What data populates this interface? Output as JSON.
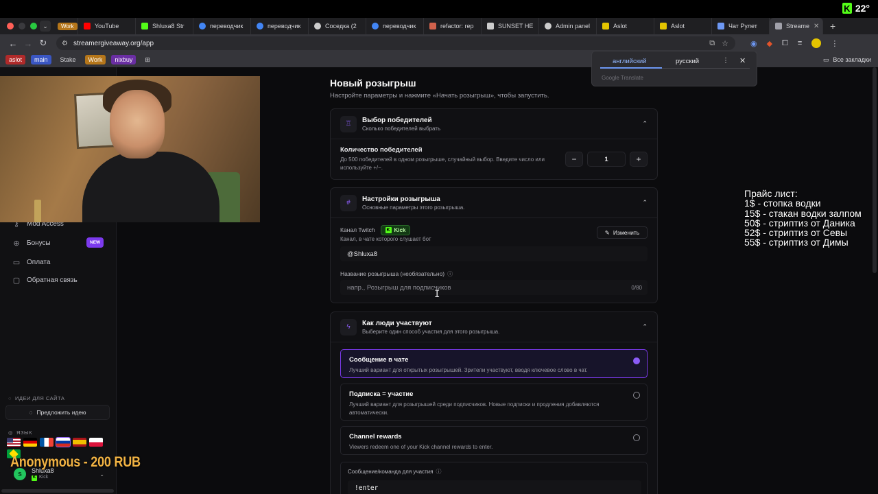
{
  "os": {
    "stream_badge": "22°"
  },
  "browser": {
    "tabs": [
      {
        "label": "Work",
        "type": "group"
      },
      {
        "label": "YouTube",
        "color": "#ff0000"
      },
      {
        "label": "Shluxa8 Str",
        "color": "#53fc18"
      },
      {
        "label": "переводчик",
        "color": "#4285f4"
      },
      {
        "label": "переводчик",
        "color": "#4285f4"
      },
      {
        "label": "Соседка (2",
        "color": "#cccccc"
      },
      {
        "label": "переводчик",
        "color": "#4285f4"
      },
      {
        "label": "refactor: rep",
        "color": "#d1624c"
      },
      {
        "label": "SUNSET HE",
        "color": "#cccccc"
      },
      {
        "label": "Admin panel",
        "color": "#cccccc"
      },
      {
        "label": "Aslot",
        "color": "#e4c400"
      },
      {
        "label": "Aslot",
        "color": "#e4c400"
      },
      {
        "label": "Чат Рулет",
        "color": "#6d98f4"
      },
      {
        "label": "Streame",
        "color": "#a1a1aa",
        "active": true
      }
    ],
    "url": "streamergiveaway.org/app",
    "bookmarks": [
      {
        "label": "aslot",
        "style": "red"
      },
      {
        "label": "main",
        "style": "blue"
      },
      {
        "label": "Stake",
        "style": "plain"
      },
      {
        "label": "Work",
        "style": "orange"
      },
      {
        "label": "nixbuy",
        "style": "purple"
      }
    ],
    "all_bookmarks_label": "Все закладки"
  },
  "translate_popup": {
    "source_lang": "английский",
    "target_lang": "русский",
    "footer": "Google Translate"
  },
  "sidebar": {
    "items": [
      {
        "label": "Mod Access",
        "icon": "key-icon"
      },
      {
        "label": "Бонусы",
        "icon": "gift-icon",
        "badge": "NEW"
      },
      {
        "label": "Оплата",
        "icon": "card-icon"
      },
      {
        "label": "Обратная связь",
        "icon": "chat-icon"
      }
    ],
    "ideas_heading": "ИДЕИ ДЛЯ САЙТА",
    "suggest_label": "Предложить идею",
    "language_heading": "ЯЗЫК",
    "user": {
      "name": "Shluxa8",
      "platform": "Kick",
      "initial": "S"
    }
  },
  "main": {
    "title": "Новый розыгрыш",
    "subtitle": "Настройте параметры и нажмите «Начать розыгрыш», чтобы запустить.",
    "winners_card": {
      "title": "Выбор победителей",
      "subtitle": "Сколько победителей выбрать",
      "count_label": "Количество победителей",
      "count_help": "До 500 победителей в одном розыгрыше, случайный выбор. Введите число или используйте +/−.",
      "count_value": "1",
      "minus": "−",
      "plus": "+"
    },
    "settings_card": {
      "title": "Настройки розыгрыша",
      "subtitle": "Основные параметры этого розыгрыша.",
      "channel_label": "Канал Twitch",
      "platform_chip": "Kick",
      "channel_help": "Канал, в чате которого слушает бот",
      "change_label": "Изменить",
      "channel_value": "@Shluxa8",
      "name_label": "Название розыгрыша (необязательно)",
      "name_placeholder": "напр., Розыгрыш для подписчиков",
      "name_counter": "0/80"
    },
    "participation_card": {
      "title": "Как люди участвуют",
      "subtitle": "Выберите один способ участия для этого розыгрыша.",
      "options": [
        {
          "title": "Сообщение в чате",
          "desc": "Лучший вариант для открытых розыгрышей. Зрители участвуют, вводя ключевое слово в чат.",
          "selected": true
        },
        {
          "title": "Подписка = участие",
          "desc": "Лучший вариант для розыгрышей среди подписчиков. Новые подписки и продления добавляются автоматически.",
          "selected": false
        },
        {
          "title": "Channel rewards",
          "desc": "Viewers redeem one of your Kick channel rewards to enter.",
          "selected": false
        }
      ],
      "command_label": "Сообщение/команда для участия",
      "command_value": "!enter"
    }
  },
  "overlays": {
    "price_list": [
      "Прайс лист:",
      "1$ - стопка водки",
      "15$ - стакан водки залпом",
      "50$ - стриптиз от Даника",
      "52$ - стриптиз от Севы",
      "55$ - стриптиз от Димы"
    ],
    "donation": "Anonymous - 200 RUB"
  }
}
